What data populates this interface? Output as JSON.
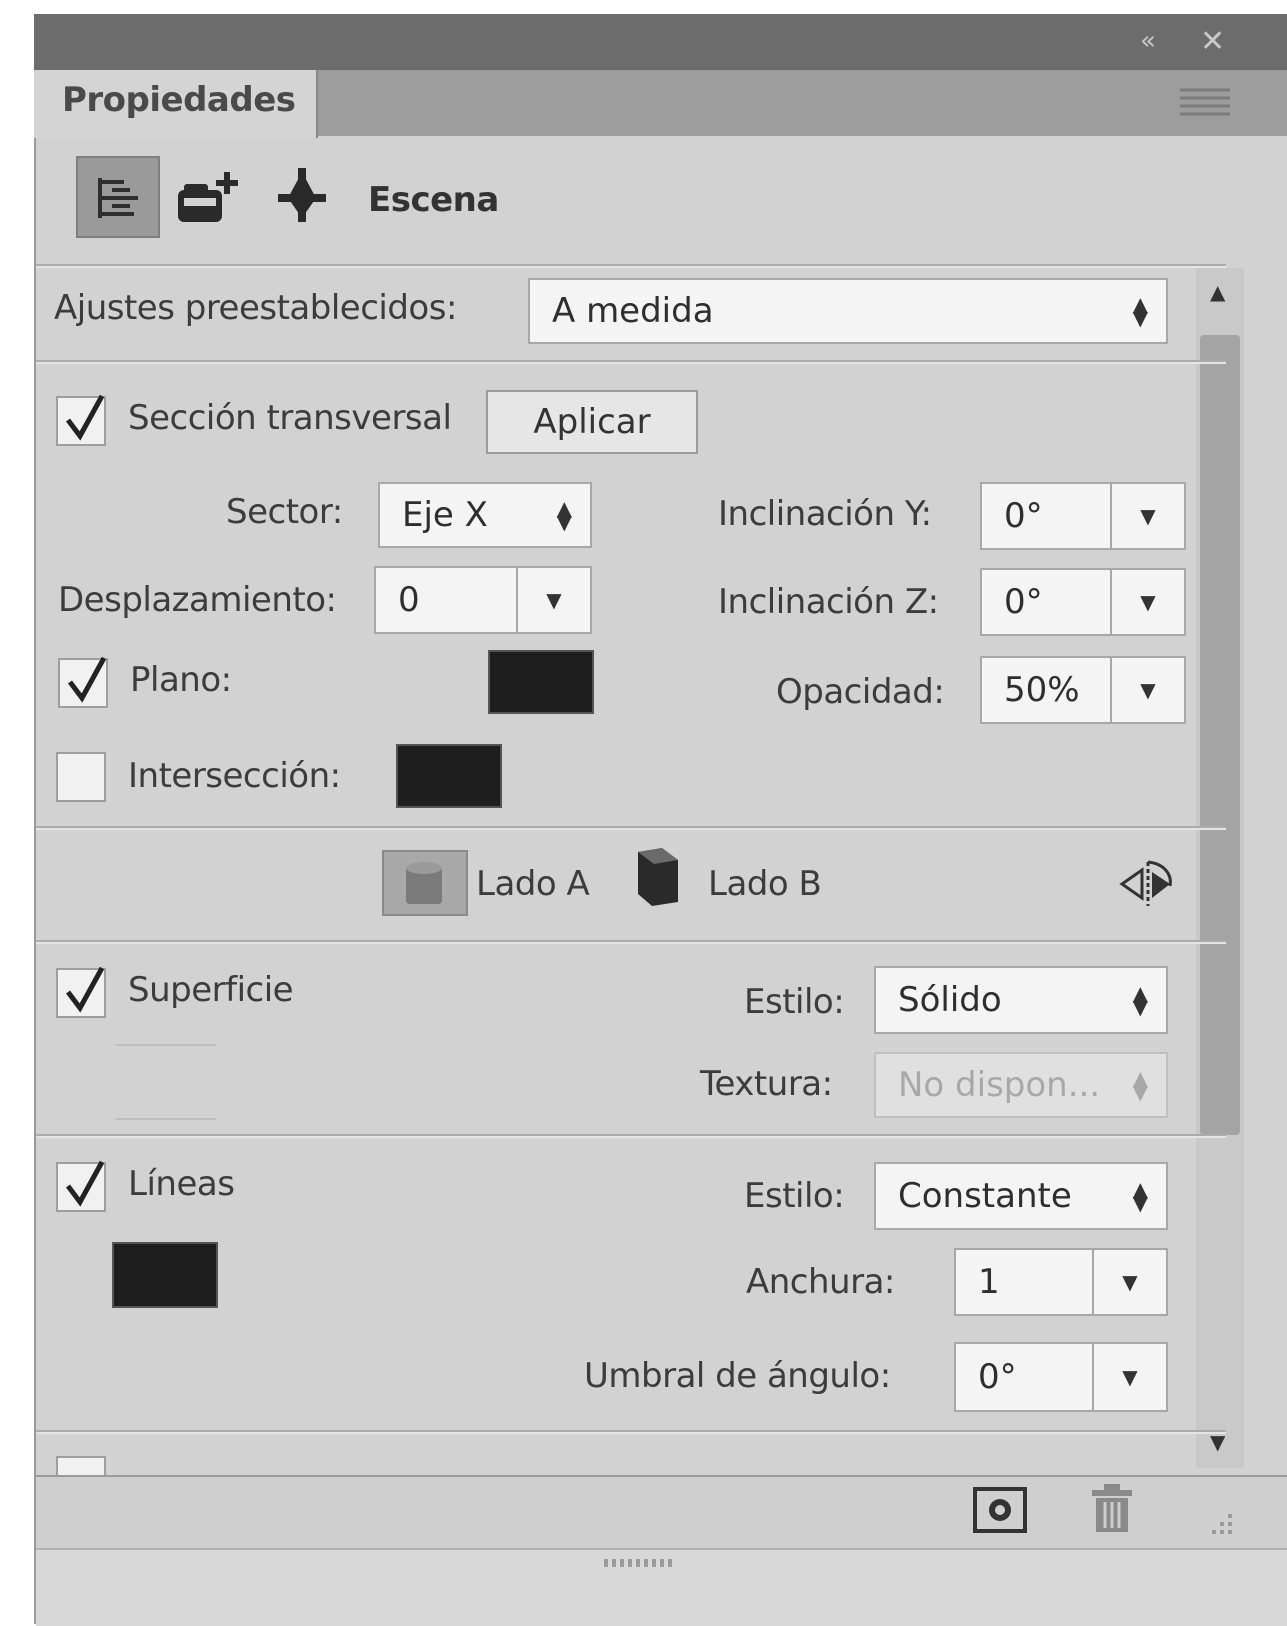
{
  "panel": {
    "tab_label": "Propiedades",
    "title_bar_controls": [
      "«",
      "✕"
    ]
  },
  "toolbar": {
    "scene_label": "Escena",
    "icons": [
      "scene-tree-icon",
      "add-camera-icon",
      "light-icon"
    ]
  },
  "presets": {
    "label": "Ajustes preestablecidos:",
    "value": "A medida"
  },
  "cross_section": {
    "checkbox_label": "Sección transversal",
    "checked": true,
    "apply_label": "Aplicar",
    "sector_label": "Sector:",
    "sector_value": "Eje X",
    "offset_label": "Desplazamiento:",
    "offset_value": "0",
    "tilt_y_label": "Inclinación Y:",
    "tilt_y_value": "0°",
    "tilt_z_label": "Inclinación Z:",
    "tilt_z_value": "0°",
    "plane_label": "Plano:",
    "plane_checked": true,
    "plane_color": "#1e1e1e",
    "opacity_label": "Opacidad:",
    "opacity_value": "50%",
    "intersection_label": "Intersección:",
    "intersection_checked": false,
    "intersection_color": "#1e1e1e"
  },
  "sides": {
    "side_a_label": "Lado A",
    "side_b_label": "Lado B"
  },
  "surface": {
    "checkbox_label": "Superficie",
    "checked": true,
    "style_label": "Estilo:",
    "style_value": "Sólido",
    "texture_label": "Textura:",
    "texture_value": "No dispon..."
  },
  "lines": {
    "checkbox_label": "Líneas",
    "checked": true,
    "color": "#1e1e1e",
    "style_label": "Estilo:",
    "style_value": "Constante",
    "width_label": "Anchura:",
    "width_value": "1",
    "angle_threshold_label": "Umbral de ángulo:",
    "angle_threshold_value": "0°"
  }
}
